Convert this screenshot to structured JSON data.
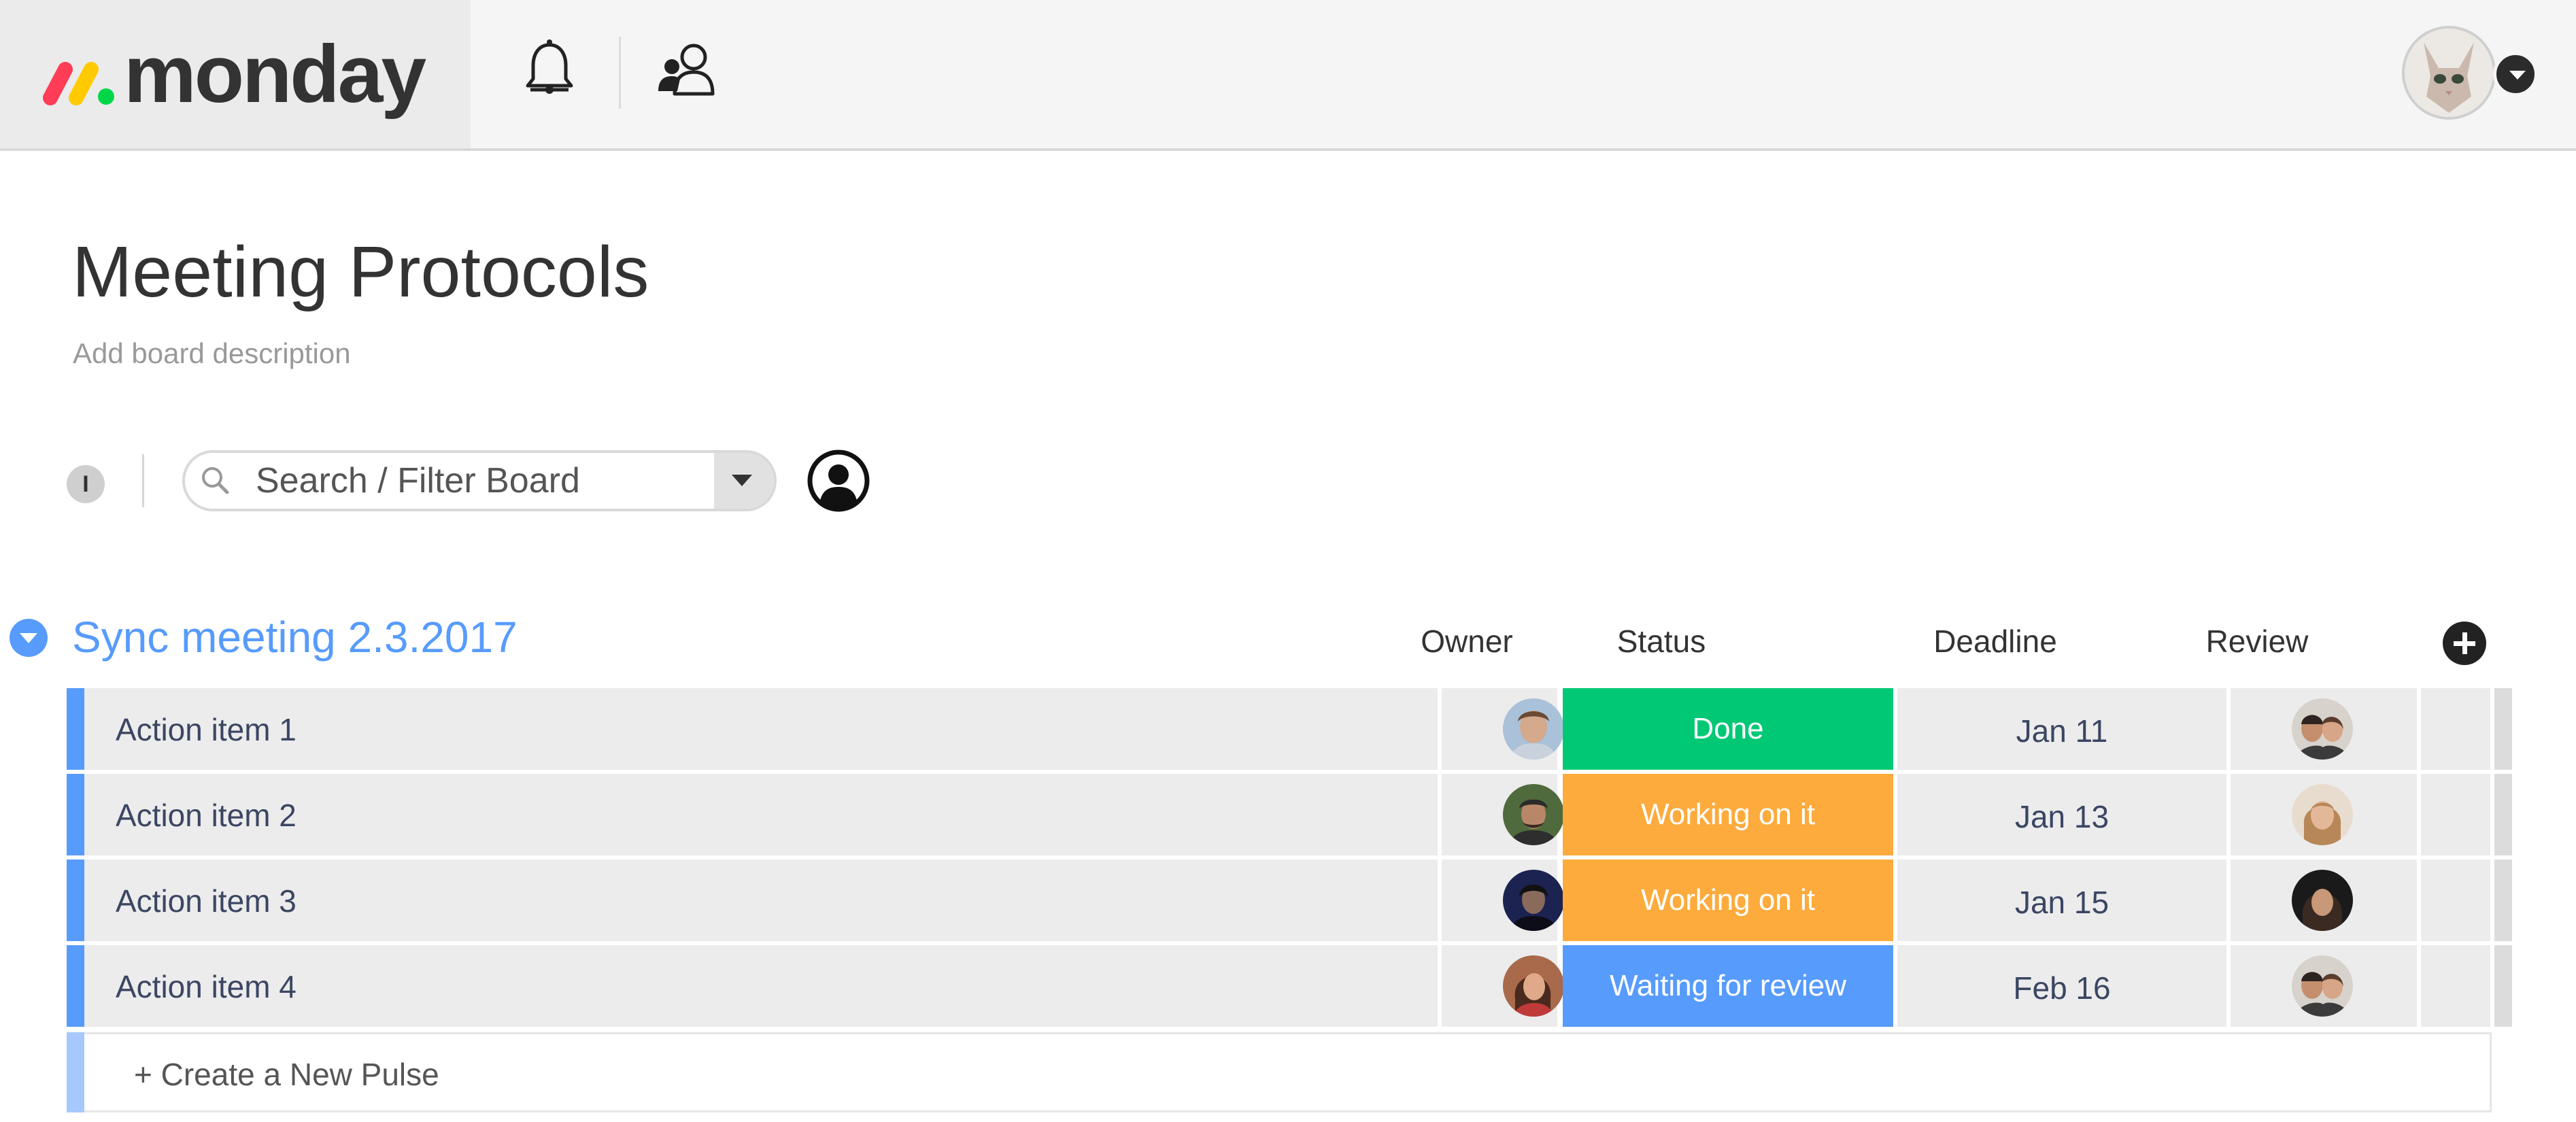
{
  "app": {
    "brand": "monday",
    "accent": "#579bfc"
  },
  "topbar": {
    "icons": [
      "bell-icon",
      "people-icon"
    ],
    "avatar": "user-avatar"
  },
  "board": {
    "title": "Meeting Protocols",
    "description_placeholder": "Add board description"
  },
  "filter": {
    "info_label": "I",
    "search_placeholder": "Search / Filter Board"
  },
  "group": {
    "title": "Sync meeting 2.3.2017",
    "color": "#579bfc",
    "columns": [
      "Owner",
      "Status",
      "Deadline",
      "Review"
    ],
    "items": [
      {
        "name": "Action item 1",
        "status": "Done",
        "status_color": "#00c875",
        "deadline": "Jan 11"
      },
      {
        "name": "Action item 2",
        "status": "Working on it",
        "status_color": "#fdab3d",
        "deadline": "Jan 13"
      },
      {
        "name": "Action item 3",
        "status": "Working on it",
        "status_color": "#fdab3d",
        "deadline": "Jan 15"
      },
      {
        "name": "Action item 4",
        "status": "Waiting for review",
        "status_color": "#579bfc",
        "deadline": "Feb 16"
      }
    ],
    "new_item_label": "+ Create a New Pulse"
  },
  "status_colors": {
    "done": "#00c875",
    "working": "#fdab3d",
    "review": "#579bfc"
  }
}
